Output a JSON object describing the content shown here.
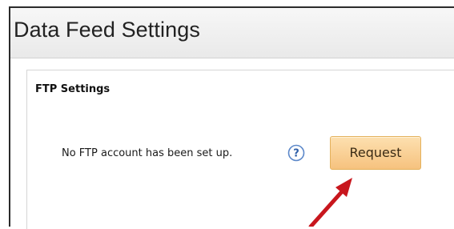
{
  "header": {
    "title": "Data Feed Settings"
  },
  "ftp_section": {
    "title": "FTP Settings",
    "status_text": "No FTP account has been set up.",
    "help_icon": "question-mark-icon",
    "request_label": "Request"
  },
  "annotation": {
    "arrow_color": "#c8161d"
  }
}
